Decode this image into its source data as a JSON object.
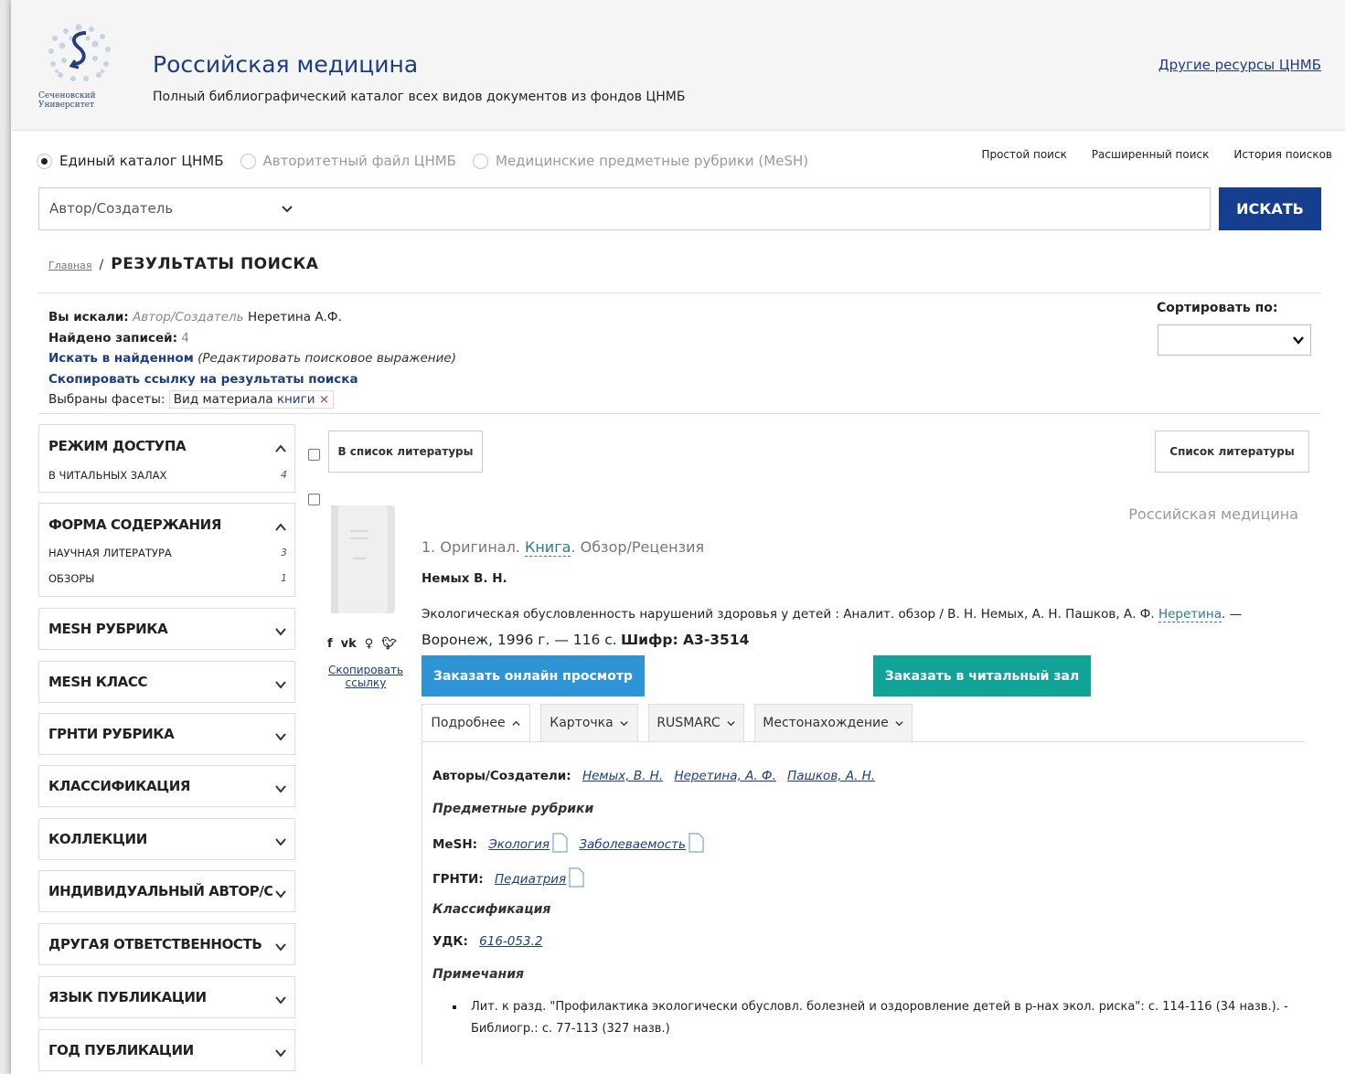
{
  "header": {
    "logo_text_line1": "Сеченовский",
    "logo_text_line2": "Университет",
    "title": "Российская медицина",
    "subtitle": "Полный библиографический каталог всех видов документов из фондов ЦНМБ",
    "other_resources": "Другие ресурсы ЦНМБ"
  },
  "search_modes": [
    {
      "label": "Единый каталог ЦНМБ",
      "selected": true
    },
    {
      "label": "Авторитетный файл ЦНМБ",
      "selected": false
    },
    {
      "label": "Медицинские предметные рубрики (MeSH)",
      "selected": false
    }
  ],
  "search_links": [
    "Простой поиск",
    "Расширенный поиск",
    "История поисков"
  ],
  "search": {
    "field": "Автор/Создатель",
    "button": "ИСКАТЬ"
  },
  "breadcrumb": {
    "home": "Главная",
    "separator": "/",
    "current": "РЕЗУЛЬТАТЫ ПОИСКА"
  },
  "query_info": {
    "searched_label": "Вы искали:",
    "searched_field": "Автор/Создатель",
    "searched_value": "Неретина А.Ф.",
    "found_label": "Найдено записей:",
    "found_count": "4",
    "search_within": "Искать в найденном",
    "edit_expression": "(Редактировать поисковое выражение)",
    "copy_results_link": "Скопировать ссылку на результаты поиска",
    "facets_label": "Выбраны фасеты:",
    "facet_name": "Вид материала",
    "facet_value": "книги",
    "facet_remove": "×"
  },
  "sort": {
    "label": "Сортировать по:",
    "value": ""
  },
  "facets": [
    {
      "title": "РЕЖИМ ДОСТУПА",
      "expanded": true,
      "items": [
        {
          "label": "В ЧИТАЛЬНЫХ ЗАЛАХ",
          "count": "4"
        }
      ]
    },
    {
      "title": "ФОРМА СОДЕРЖАНИЯ",
      "expanded": true,
      "items": [
        {
          "label": "НАУЧНАЯ ЛИТЕРАТУРА",
          "count": "3"
        },
        {
          "label": "ОБЗОРЫ",
          "count": "1"
        }
      ]
    },
    {
      "title": "MESH РУБРИКА",
      "expanded": false
    },
    {
      "title": "MESH КЛАСС",
      "expanded": false
    },
    {
      "title": "ГРНТИ РУБРИКА",
      "expanded": false
    },
    {
      "title": "КЛАССИФИКАЦИЯ",
      "expanded": false
    },
    {
      "title": "КОЛЛЕКЦИИ",
      "expanded": false
    },
    {
      "title": "ИНДИВИДУАЛЬНЫЙ АВТОР/СОАВТОР",
      "expanded": false
    },
    {
      "title": "ДРУГАЯ ОТВЕТСТВЕННОСТЬ",
      "expanded": false
    },
    {
      "title": "ЯЗЫК ПУБЛИКАЦИИ",
      "expanded": false
    },
    {
      "title": "ГОД ПУБЛИКАЦИИ",
      "expanded": false
    }
  ],
  "toolbar": {
    "add_to_list": "В список литературы",
    "list": "Список литературы"
  },
  "record": {
    "source": "Российская медицина",
    "number": "1.",
    "type_original": "Оригинал.",
    "type_book": "Книга",
    "type_rest": ". Обзор/Рецензия",
    "author": "Немых В. Н.",
    "description_part1": "Экологическая обусловленность нарушений здоровья у детей : Аналит. обзор / В. Н. Немых, А. Н. Пашков, А. Ф.",
    "description_link": "Неретина",
    "description_part2": ". —",
    "description_place": "Воронеж, 1996 г. — 116 с.",
    "cipher": "Шифр: А3-3514",
    "social": [
      "f",
      "vk",
      "ok",
      "tw"
    ],
    "copy_link": "Скопировать ссылку",
    "order_online": "Заказать онлайн просмотр",
    "order_reading": "Заказать в читальный зал",
    "tabs": [
      "Подробнее",
      "Карточка",
      "RUSMARC",
      "Местонахождение"
    ],
    "details": {
      "authors_label": "Авторы/Создатели:",
      "authors": [
        "Немых, В. Н.",
        "Неретина, А. Ф.",
        "Пашков, А. Н."
      ],
      "subjects_head": "Предметные рубрики",
      "mesh_label": "MeSH:",
      "mesh": [
        "Экология",
        "Заболеваемость"
      ],
      "grnti_label": "ГРНТИ:",
      "grnti": [
        "Педиатрия"
      ],
      "class_head": "Классификация",
      "udk_label": "УДК:",
      "udk": "616-053.2",
      "notes_head": "Примечания",
      "note": "Лит. к разд. \"Профилактика экологически обусловл. болезней и оздоровление детей в р-нах экол. риска\": с. 114-116 (34 назв.). - Библиогр.: с. 77-113 (327 назв.)"
    }
  }
}
